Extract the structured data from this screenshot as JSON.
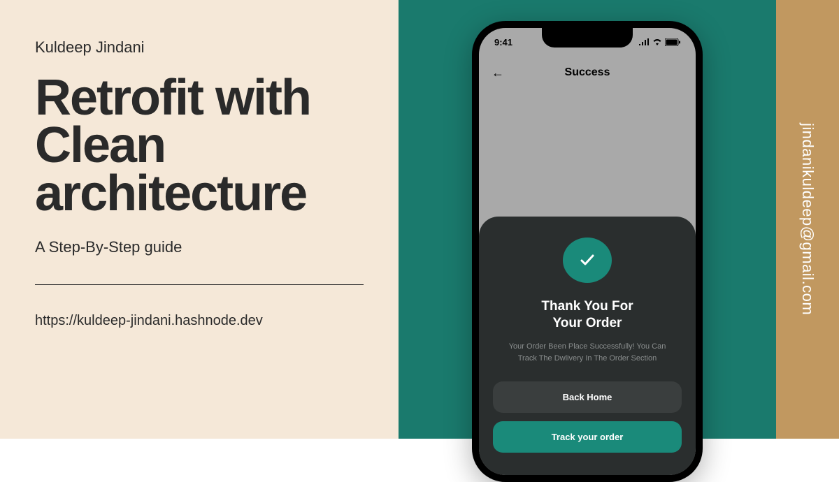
{
  "left": {
    "author": "Kuldeep Jindani",
    "title_line1": "Retrofit with",
    "title_line2": "Clean",
    "title_line3": "architecture",
    "subtitle": "A Step-By-Step guide",
    "url": "https://kuldeep-jindani.hashnode.dev"
  },
  "phone": {
    "time": "9:41",
    "header_title": "Success",
    "sheet_title_line1": "Thank You For",
    "sheet_title_line2": "Your Order",
    "sheet_desc": "Your Order Been Place Successfully! You Can Track The Dwlivery In The Order Section",
    "btn_back": "Back Home",
    "btn_track": "Track your order"
  },
  "right": {
    "email": "jindanikuldeep@gmail.com"
  }
}
